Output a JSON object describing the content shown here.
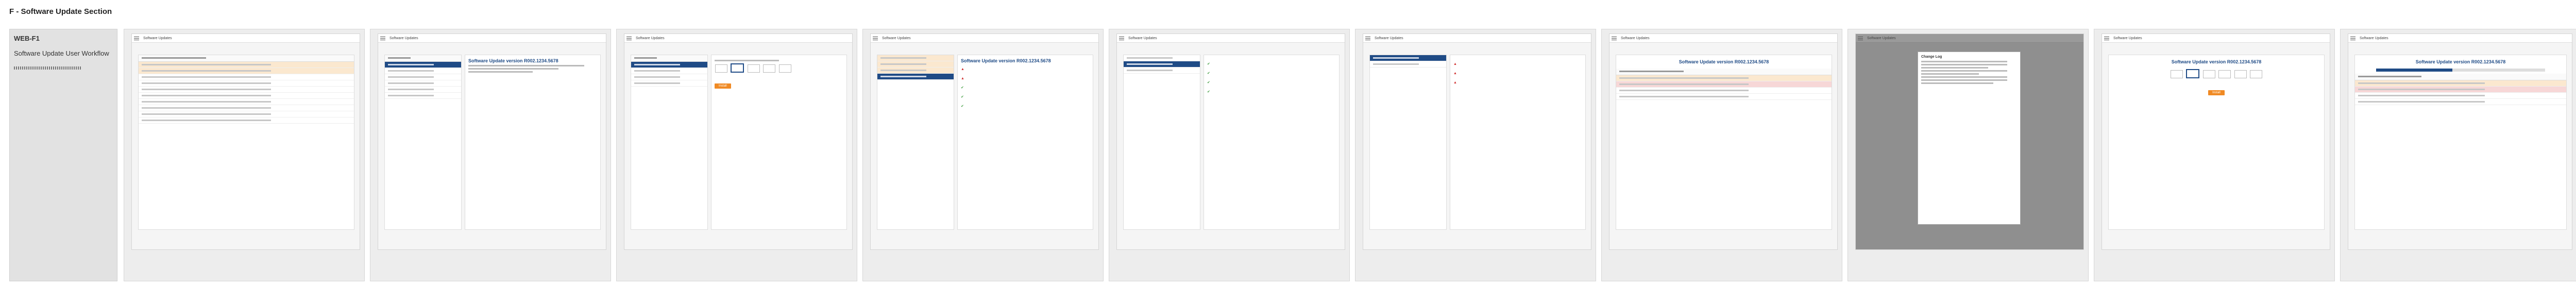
{
  "section": {
    "title": "F - Software Update Section",
    "code": "WEB-F1",
    "flow_name": "Software Update User Workflow"
  },
  "screen_title": "Software Updates",
  "update_title": "Software Update version R002.1234.5678",
  "install_button": "Install",
  "dialog_title": "Change Log",
  "progress_fraction": 0.45,
  "frames": [
    {
      "variant": "list"
    },
    {
      "variant": "detail-selected"
    },
    {
      "variant": "schedule"
    },
    {
      "variant": "checklist"
    },
    {
      "variant": "tabs-list"
    },
    {
      "variant": "warnings"
    },
    {
      "variant": "summary"
    },
    {
      "variant": "dialog"
    },
    {
      "variant": "dates"
    },
    {
      "variant": "progress"
    }
  ]
}
